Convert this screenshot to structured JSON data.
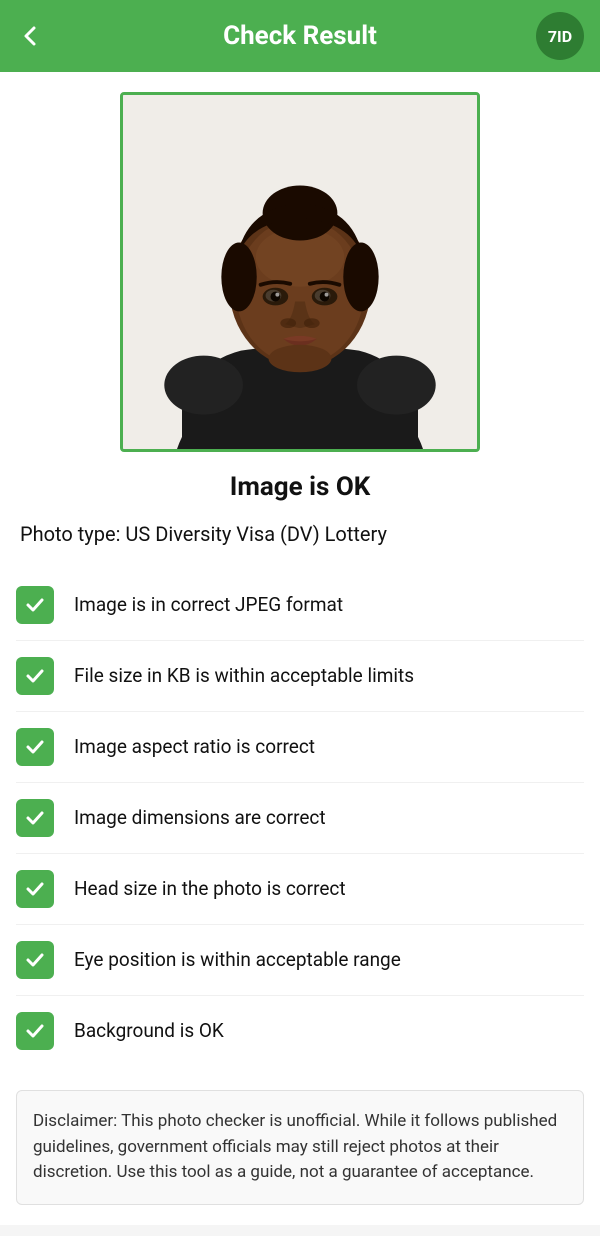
{
  "header": {
    "title": "Check Result",
    "back_icon": "←",
    "logo_text": "7ID"
  },
  "photo": {
    "alt": "Passport photo of a young woman"
  },
  "result_title": "Image is OK",
  "photo_type_label": "Photo type: US Diversity Visa (DV) Lottery",
  "checks": [
    {
      "label": "Image is in correct JPEG format"
    },
    {
      "label": "File size in KB is within acceptable limits"
    },
    {
      "label": "Image aspect ratio is correct"
    },
    {
      "label": "Image dimensions are correct"
    },
    {
      "label": "Head size in the photo is correct"
    },
    {
      "label": "Eye position is within acceptable range"
    },
    {
      "label": "Background is OK"
    }
  ],
  "disclaimer": "Disclaimer: This photo checker is unofficial. While it follows published guidelines, government officials may still reject photos at their discretion. Use this tool as a guide, not a guarantee of acceptance."
}
